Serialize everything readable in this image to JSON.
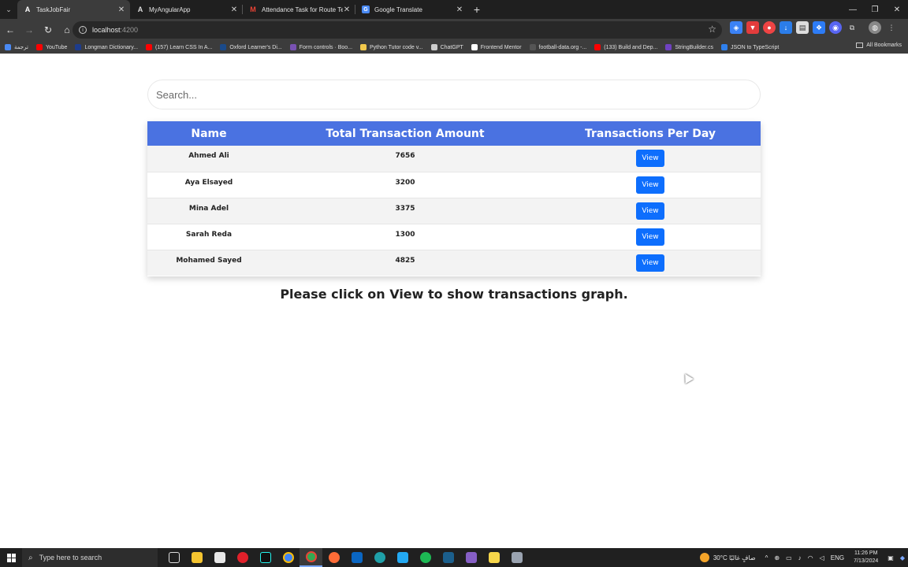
{
  "browser": {
    "tabs": [
      {
        "title": "TaskJobFair",
        "icon": "angular-icon",
        "active": true
      },
      {
        "title": "MyAngularApp",
        "icon": "angular-icon",
        "active": false
      },
      {
        "title": "Attendance Task for Route Tech",
        "icon": "gmail-icon",
        "active": false
      },
      {
        "title": "Google Translate",
        "icon": "translate-icon",
        "active": false
      }
    ],
    "address": {
      "host": "localhost",
      "port": ":4200"
    },
    "bookmarks": [
      {
        "label": "ترجمة",
        "color": "#4a8af4"
      },
      {
        "label": "YouTube",
        "color": "#ff0000"
      },
      {
        "label": "Longman Dictionary...",
        "color": "#1d3c8c"
      },
      {
        "label": "(157) Learn CSS In A...",
        "color": "#ff0000"
      },
      {
        "label": "Oxford Learner's Di...",
        "color": "#1a4a8a"
      },
      {
        "label": "Form controls · Boo...",
        "color": "#7952b3"
      },
      {
        "label": "Python Tutor code v...",
        "color": "#f2c94c"
      },
      {
        "label": "ChatGPT",
        "color": "#cccccc"
      },
      {
        "label": "Frontend Mentor",
        "color": "#ffffff"
      },
      {
        "label": "football-data.org -...",
        "color": "#555555"
      },
      {
        "label": "(133) Build and Dep...",
        "color": "#ff0000"
      },
      {
        "label": "StringBuilder.cs",
        "color": "#6f42c1"
      },
      {
        "label": "JSON to TypeScript",
        "color": "#2f80ed"
      }
    ],
    "all_bookmarks_label": "All Bookmarks"
  },
  "page": {
    "search": {
      "placeholder": "Search..."
    },
    "table": {
      "headers": [
        "Name",
        "Total Transaction Amount",
        "Transactions Per Day"
      ],
      "rows": [
        {
          "name": "Ahmed Ali",
          "total": "7656",
          "action": "View"
        },
        {
          "name": "Aya Elsayed",
          "total": "3200",
          "action": "View"
        },
        {
          "name": "Mina Adel",
          "total": "3375",
          "action": "View"
        },
        {
          "name": "Sarah Reda",
          "total": "1300",
          "action": "View"
        },
        {
          "name": "Mohamed Sayed",
          "total": "4825",
          "action": "View"
        }
      ]
    },
    "hint": "Please click on View to show transactions graph."
  },
  "taskbar": {
    "search_placeholder": "Type here to search",
    "weather": "30°C  صافٍ غالبًا",
    "language": "ENG",
    "time": "11:26 PM",
    "date": "7/13/2024"
  },
  "colors": {
    "table_header": "#4a72e1",
    "button": "#0d6efd"
  }
}
